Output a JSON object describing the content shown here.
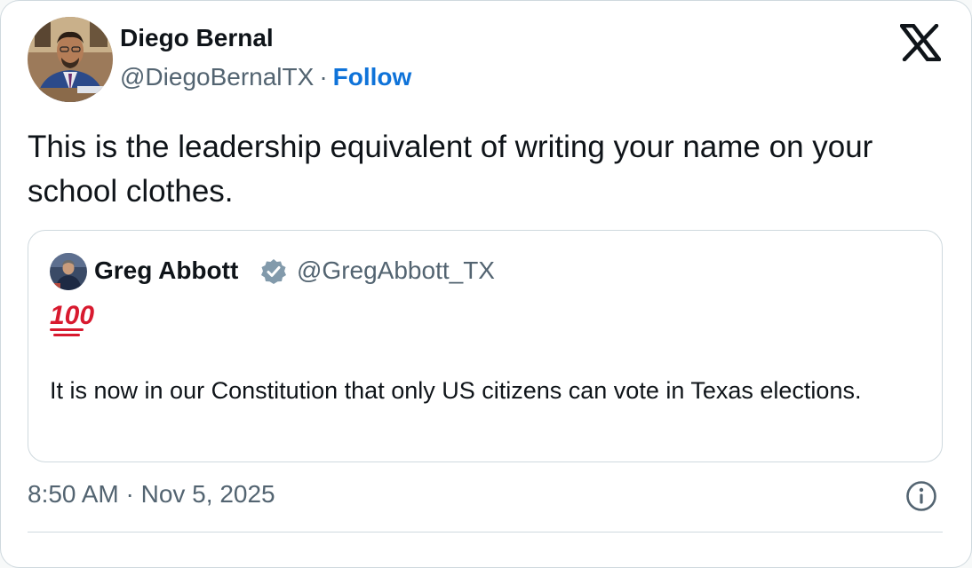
{
  "tweet": {
    "author": {
      "name": "Diego Bernal",
      "handle": "@DiegoBernalTX",
      "separator": "·",
      "follow_label": "Follow"
    },
    "text": "This is the leadership equivalent of writing your name on your school clothes.",
    "quoted": {
      "name": "Greg Abbott",
      "handle": "@GregAbbott_TX",
      "emoji": "100",
      "text": "It is now in our Constitution that only US citizens can vote in Texas elections."
    },
    "timestamp": "8:50 AM · Nov 5, 2025"
  },
  "icons": {
    "logo": "x-logo-icon",
    "verified": "verified-badge-icon",
    "info": "info-icon"
  },
  "colors": {
    "follow": "#0f73d9",
    "secondary_text": "#536471",
    "border": "#cfd9de",
    "emoji_red": "#d81a2f"
  }
}
